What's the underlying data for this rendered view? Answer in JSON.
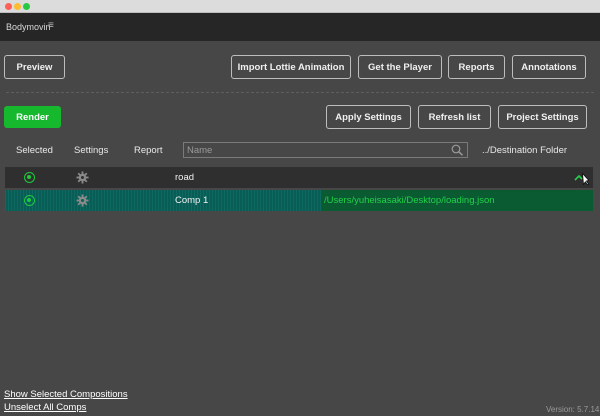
{
  "panel": {
    "title": "Bodymovin",
    "menu_glyph": "≡"
  },
  "toolbar": {
    "preview": "Preview",
    "import_lottie": "Import Lottie Animation",
    "get_player": "Get the Player",
    "reports": "Reports",
    "annotations": "Annotations"
  },
  "actions": {
    "render": "Render",
    "apply_settings": "Apply Settings",
    "refresh_list": "Refresh list",
    "project_settings": "Project Settings"
  },
  "table": {
    "headers": {
      "selected": "Selected",
      "settings": "Settings",
      "report": "Report",
      "destination": "../Destination Folder"
    },
    "search_placeholder": "Name",
    "rows": [
      {
        "name": "road",
        "destination": "",
        "selected": true
      },
      {
        "name": "Comp 1",
        "destination": "/Users/yuheisasaki/Desktop/loading.json",
        "selected": true
      }
    ]
  },
  "footer": {
    "show_selected": "Show Selected Compositions",
    "unselect_all": "Unselect All Comps",
    "version": "Version: 5.7.14"
  },
  "colors": {
    "accent_green": "#16b82e",
    "selected_row": "#0a5a32",
    "background": "#474747"
  },
  "icons": [
    "search-icon",
    "gear-icon",
    "radio-selected-icon",
    "destination-folder-icon",
    "cursor-icon",
    "menu-icon"
  ]
}
